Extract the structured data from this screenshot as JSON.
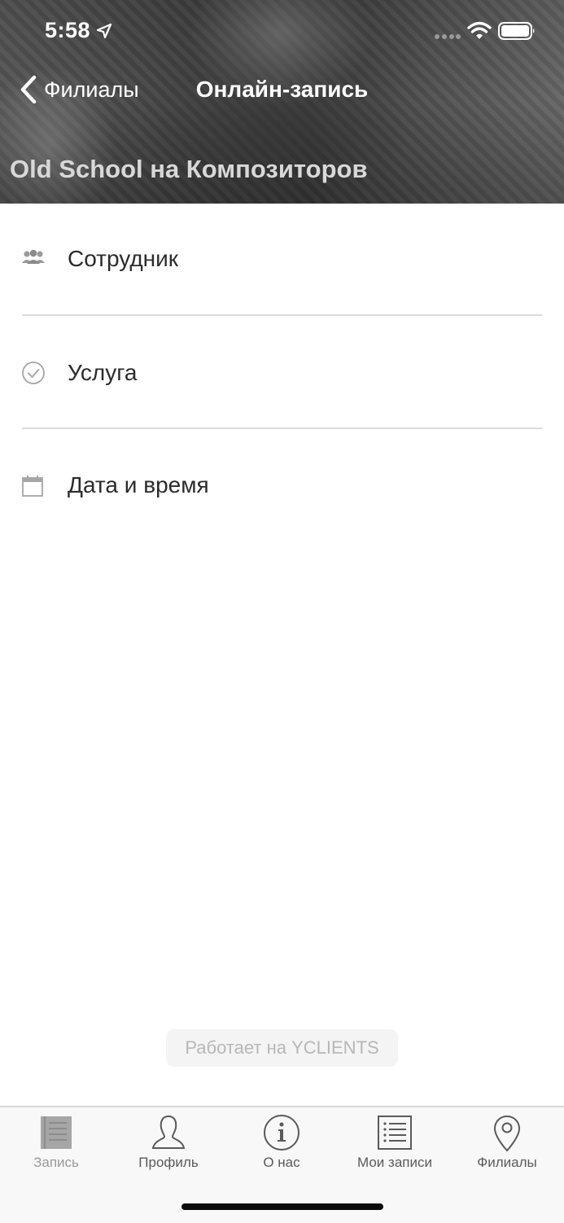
{
  "status_bar": {
    "time": "5:58"
  },
  "nav": {
    "back_label": "Филиалы",
    "title": "Онлайн-запись"
  },
  "branch": {
    "name": "Old School на Композиторов"
  },
  "form": {
    "rows": [
      {
        "label": "Сотрудник",
        "icon": "people-icon"
      },
      {
        "label": "Услуга",
        "icon": "check-circle-icon"
      },
      {
        "label": "Дата и время",
        "icon": "calendar-icon"
      }
    ]
  },
  "footer": {
    "powered_by": "Работает на YCLIENTS"
  },
  "tabs": [
    {
      "label": "Запись",
      "icon": "book-icon",
      "active": true
    },
    {
      "label": "Профиль",
      "icon": "profile-icon"
    },
    {
      "label": "О нас",
      "icon": "info-icon"
    },
    {
      "label": "Мои записи",
      "icon": "list-icon"
    },
    {
      "label": "Филиалы",
      "icon": "map-pin-icon"
    }
  ],
  "colors": {
    "accent": "#ffffff",
    "text": "#2b2b2b",
    "divider": "#dcdcdc",
    "tab_active": "#9a9a9a",
    "tab_inactive": "#5a5a5a"
  }
}
